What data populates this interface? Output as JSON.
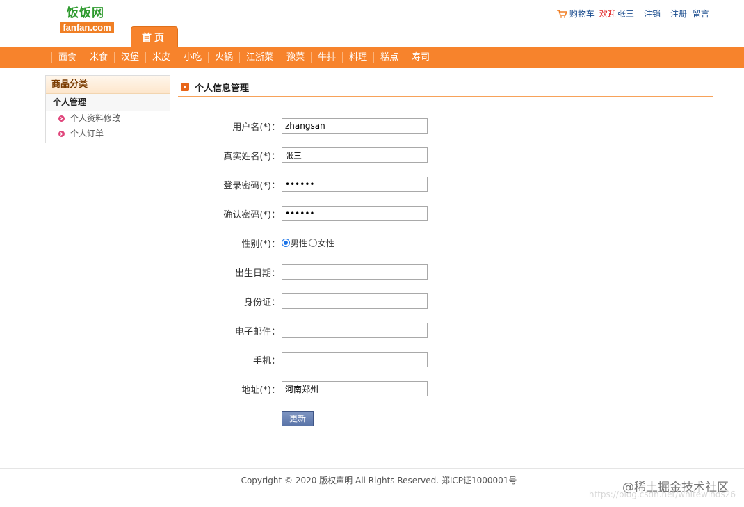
{
  "header": {
    "logo_cn": "饭饭网",
    "logo_en": "fanfan.com",
    "home_tab": "首页",
    "cart_label": "购物车",
    "welcome": "欢迎",
    "username": "张三",
    "logout": "注销",
    "register": "注册",
    "message": "留言"
  },
  "nav": {
    "items": [
      "面食",
      "米食",
      "汉堡",
      "米皮",
      "小吃",
      "火锅",
      "江浙菜",
      "豫菜",
      "牛排",
      "料理",
      "糕点",
      "寿司"
    ]
  },
  "sidebar": {
    "title": "商品分类",
    "group": "个人管理",
    "links": [
      "个人资料修改",
      "个人订单"
    ]
  },
  "main": {
    "title": "个人信息管理"
  },
  "form": {
    "username_label": "用户名(*)：",
    "username_value": "zhangsan",
    "realname_label": "真实姓名(*)：",
    "realname_value": "张三",
    "password_label": "登录密码(*)：",
    "password_value": "••••••",
    "confirm_label": "确认密码(*)：",
    "confirm_value": "••••••",
    "gender_label": "性别(*)：",
    "gender_male": "男性",
    "gender_female": "女性",
    "gender_selected": "男性",
    "birthday_label": "出生日期：",
    "birthday_value": "",
    "idcard_label": "身份证：",
    "idcard_value": "",
    "email_label": "电子邮件：",
    "email_value": "",
    "phone_label": "手机：",
    "phone_value": "",
    "address_label": "地址(*)：",
    "address_value": "河南郑州",
    "submit_label": "更新"
  },
  "footer": {
    "copyright": "Copyright © 2020 版权声明 All Rights Reserved. 郑ICP证1000001号",
    "watermark_1": "@稀土掘金技术社区",
    "watermark_2": "https://blog.csdn.net/whitewinds26"
  },
  "colors": {
    "accent": "#f7832c",
    "link": "#1a4c8e",
    "welcome": "#e02020",
    "logo_green": "#2e9a2e"
  }
}
